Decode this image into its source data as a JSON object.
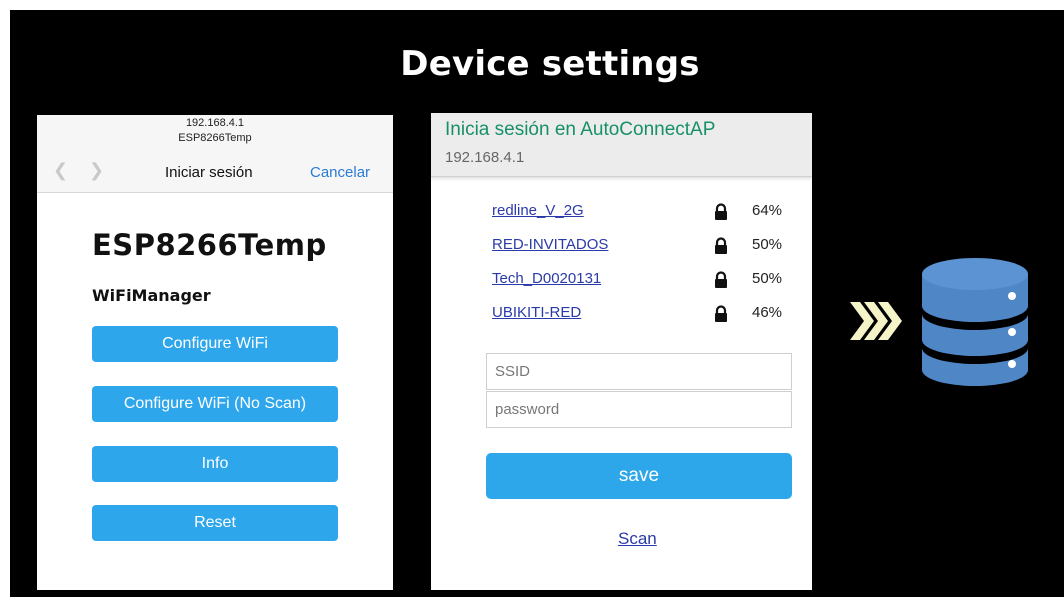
{
  "slide": {
    "title": "Device settings"
  },
  "left_panel": {
    "ip": "192.168.4.1",
    "device_name": "ESP8266Temp",
    "back_icon": "chevron-left-icon",
    "forward_icon": "chevron-right-icon",
    "login_label": "Iniciar sesión",
    "cancel_label": "Cancelar",
    "heading": "ESP8266Temp",
    "subheading": "WiFiManager",
    "buttons": [
      {
        "label": "Configure WiFi"
      },
      {
        "label": "Configure WiFi (No Scan)"
      },
      {
        "label": "Info"
      },
      {
        "label": "Reset"
      }
    ],
    "accent_color": "#2da6ec"
  },
  "middle_panel": {
    "title": "Inicia sesión en AutoConnectAP",
    "ip": "192.168.4.1",
    "networks": [
      {
        "ssid": "redline_V_2G",
        "signal": "64%",
        "icon": "lock-icon"
      },
      {
        "ssid": "RED-INVITADOS",
        "signal": "50%",
        "icon": "lock-icon"
      },
      {
        "ssid": "Tech_D0020131",
        "signal": "50%",
        "icon": "lock-icon"
      },
      {
        "ssid": "UBIKITI-RED",
        "signal": "46%",
        "icon": "lock-icon"
      }
    ],
    "ssid_placeholder": "SSID",
    "password_placeholder": "password",
    "save_label": "save",
    "scan_label": "Scan",
    "title_color": "#17906a",
    "link_color": "#2a3aa8"
  },
  "right_side": {
    "arrow_icon": "triple-chevron-right-icon",
    "arrow_color": "#f4f4c8",
    "database_icon": "database-icon",
    "database_color": "#4f86c6"
  }
}
